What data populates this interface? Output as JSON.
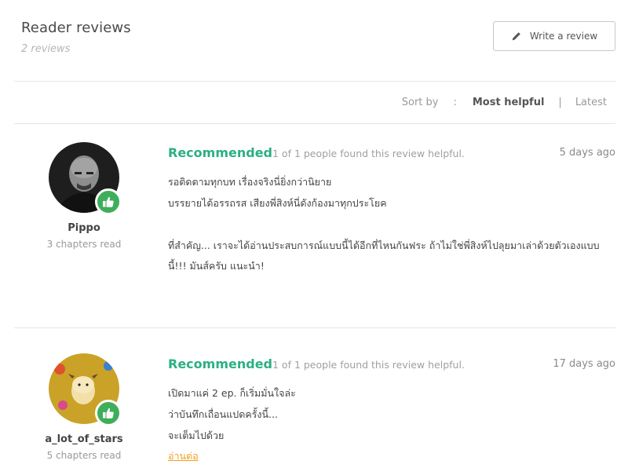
{
  "header": {
    "title": "Reader reviews",
    "count": "2 reviews",
    "write_button": "Write a review",
    "write_icon": "pencil-icon"
  },
  "sort": {
    "label": "Sort by",
    "colon": ":",
    "options": [
      "Most helpful",
      "Latest"
    ],
    "selected": "Most helpful",
    "separator": "|"
  },
  "reviews": [
    {
      "username": "Pippo",
      "chapters": "3 chapters read",
      "verdict": "Recommended",
      "helpful": "1 of 1 people found this review helpful.",
      "time_ago": "5 days ago",
      "badge_icon": "thumbs-up-icon",
      "lines": [
        "รอติดตามทุกบท เรื่องจริงนี่ยิ่งกว่านิยาย",
        "บรรยายได้อรรถรส เสียงพี่สิงห์นี่ดังก้องมาทุกประโยค",
        "",
        "ที่สำคัญ... เราจะได้อ่านประสบการณ์แบบนี้ได้อีกที่ไหนกันฟระ ถ้าไม่ใช่พี่สิงห์ไปลุยมาเล่าด้วยตัวเองแบบ",
        "นี้!!! มันส์ครับ แนะนำ!"
      ]
    },
    {
      "username": "a_lot_of_stars",
      "chapters": "5 chapters read",
      "verdict": "Recommended",
      "helpful": "1 of 1 people found this review helpful.",
      "time_ago": "17 days ago",
      "badge_icon": "thumbs-up-icon",
      "lines": [
        "เปิดมาแค่ 2 ep. ก็เริ่มมั่นใจล่ะ",
        "ว่าบันทึกเถื่อนแปดครั้งนี้...",
        "จะเต็มไปด้วย"
      ],
      "read_more": "อ่านต่อ"
    }
  ],
  "colors": {
    "recommended": "#2bb080",
    "badge": "#3fae5a",
    "read_more": "#f0a020"
  }
}
